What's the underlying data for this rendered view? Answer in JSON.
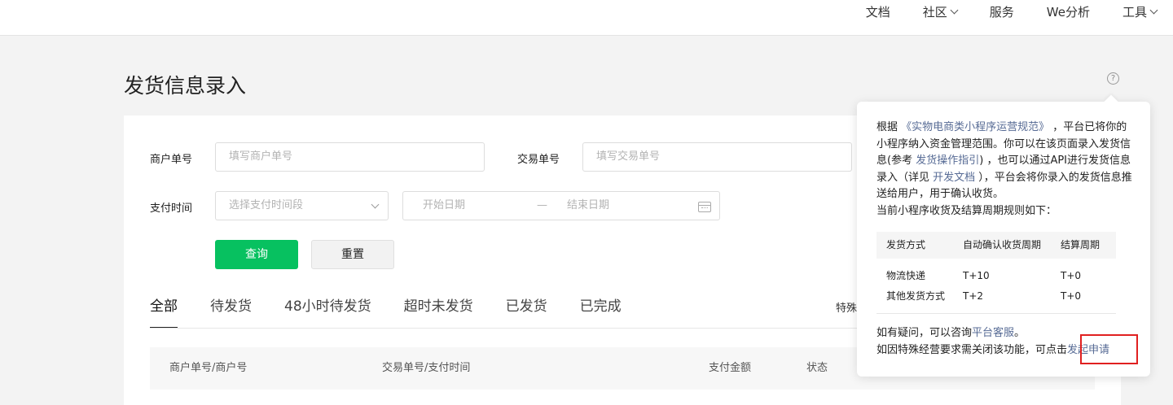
{
  "topnav": {
    "docs": "文档",
    "community": "社区",
    "service": "服务",
    "we_analysis": "We分析",
    "tools": "工具"
  },
  "page": {
    "title": "发货信息录入",
    "help_icon": "?"
  },
  "filters": {
    "merchant_order_label": "商户单号",
    "merchant_order_placeholder": "填写商户单号",
    "trade_order_label": "交易单号",
    "trade_order_placeholder": "填写交易单号",
    "pay_time_label": "支付时间",
    "pay_time_select_placeholder": "选择支付时间段",
    "start_date_placeholder": "开始日期",
    "date_separator": "—",
    "end_date_placeholder": "结束日期",
    "query_button": "查询",
    "reset_button": "重置"
  },
  "tabs": [
    {
      "label": "全部",
      "active": true
    },
    {
      "label": "待发货"
    },
    {
      "label": "48小时待发货"
    },
    {
      "label": "超时未发货"
    },
    {
      "label": "已发货"
    },
    {
      "label": "已完成"
    }
  ],
  "tab_extra": "特殊",
  "table": {
    "headers": [
      "商户单号/商户号",
      "交易单号/支付时间",
      "支付金额",
      "状态"
    ]
  },
  "popover": {
    "p1_a": "根据 ",
    "p1_link1": "《实物电商类小程序运营规范》",
    "p1_b": " ，平台已将你的小程序纳入资金管理范围。你可以在该页面录入发货信息(参考 ",
    "p1_link2": "发货操作指引",
    "p1_c": ") ，也可以通过API进行发货信息录入（详见 ",
    "p1_link3": "开发文档",
    "p1_d": " ），平台会将你录入的发货信息推送给用户，用于确认收货。",
    "p2": "当前小程序收货及结算周期规则如下：",
    "rules": {
      "headers": [
        "发货方式",
        "自动确认收货周期",
        "结算周期"
      ],
      "rows": [
        [
          "物流快递",
          "T+10",
          "T+0"
        ],
        [
          "其他发货方式",
          "T+2",
          "T+0"
        ]
      ]
    },
    "foot1_a": "如有疑问，可以咨询",
    "foot1_link": "平台客服",
    "foot1_b": "。",
    "foot2_a": "如因特殊经营要求需关闭该功能，可点击",
    "foot2_link": "发起申请"
  },
  "colors": {
    "primary": "#07c160",
    "link": "#576b95",
    "highlight": "#e02020"
  }
}
